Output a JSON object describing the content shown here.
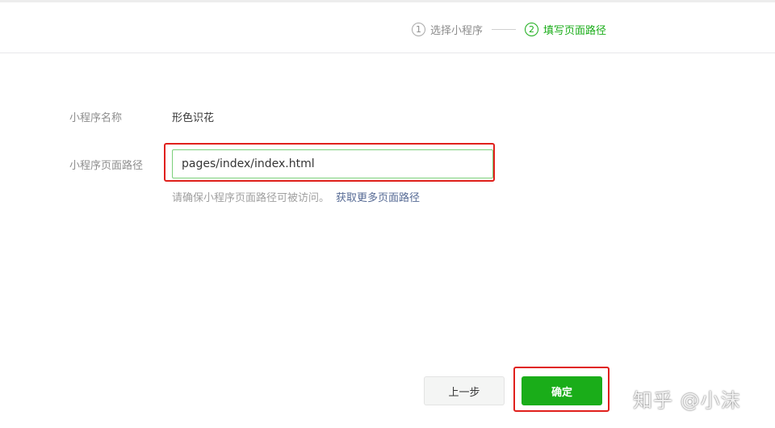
{
  "steps": [
    {
      "number": "1",
      "label": "选择小程序",
      "state": "done"
    },
    {
      "number": "2",
      "label": "填写页面路径",
      "state": "active"
    }
  ],
  "form": {
    "name_label": "小程序名称",
    "name_value": "形色识花",
    "path_label": "小程序页面路径",
    "path_value": "pages/index/index.html",
    "hint_text": "请确保小程序页面路径可被访问。",
    "hint_link": "获取更多页面路径"
  },
  "buttons": {
    "prev": "上一步",
    "confirm": "确定"
  },
  "watermark": "知乎 @小沫",
  "colors": {
    "accent_green": "#1aad19",
    "highlight_red": "#e0201c",
    "link_blue": "#576b95"
  }
}
